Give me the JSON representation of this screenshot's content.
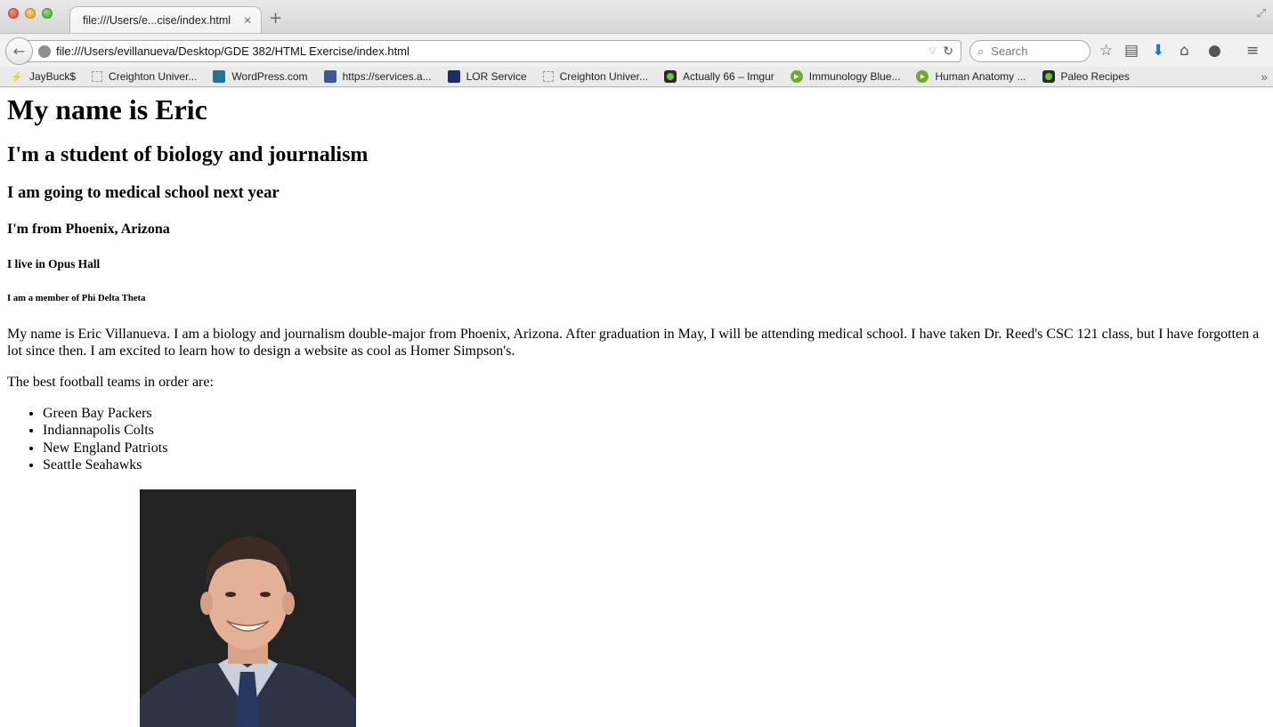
{
  "browser": {
    "tab_title": "file:///Users/e...cise/index.html",
    "url": "file:///Users/evillanueva/Desktop/GDE 382/HTML Exercise/index.html",
    "search_placeholder": "Search"
  },
  "bookmarks": [
    {
      "label": "JayBuck$",
      "icon": "jaybucks-icon",
      "color": "#d0322a"
    },
    {
      "label": "Creighton Univer...",
      "icon": "dotted-page-icon",
      "color": "#9a9a9a"
    },
    {
      "label": "WordPress.com",
      "icon": "wordpress-icon",
      "color": "#21759b"
    },
    {
      "label": "https://services.a...",
      "icon": "services-icon",
      "color": "#3b5998"
    },
    {
      "label": "LOR Service",
      "icon": "cu-icon",
      "color": "#1d2a6b"
    },
    {
      "label": "Creighton Univer...",
      "icon": "dotted-page-icon",
      "color": "#9a9a9a"
    },
    {
      "label": "Actually 66 – Imgur",
      "icon": "imgur-icon",
      "color": "#2a2a2a"
    },
    {
      "label": "Immunology Blue...",
      "icon": "play-icon",
      "color": "#6cab2c"
    },
    {
      "label": "Human Anatomy ...",
      "icon": "play-icon",
      "color": "#6cab2c"
    },
    {
      "label": "Paleo Recipes",
      "icon": "paleo-icon",
      "color": "#2a2a2a"
    }
  ],
  "page": {
    "h1": "My name is Eric",
    "h2": "I'm a student of biology and journalism",
    "h3": "I am going to medical school next year",
    "h4": "I'm from Phoenix, Arizona",
    "h5": "I live in Opus Hall",
    "h6": "I am a member of Phi Delta Theta",
    "bio": "My name is Eric Villanueva. I am a biology and journalism double-major from Phoenix, Arizona. After graduation in May, I will be attending medical school. I have taken Dr. Reed's CSC 121 class, but I have forgotten a lot since then. I am excited to learn how to design a website as cool as Homer Simpson's.",
    "teams_intro": "The best football teams in order are:",
    "teams": [
      "Green Bay Packers",
      "Indiannapolis Colts",
      "New England Patriots",
      "Seattle Seahawks"
    ]
  }
}
